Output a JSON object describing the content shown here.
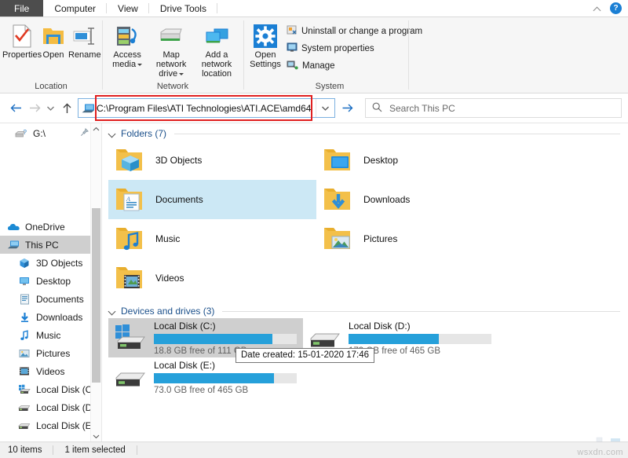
{
  "window": {
    "tabs": [
      {
        "label": "File",
        "type": "file"
      },
      {
        "label": "Computer",
        "type": "active"
      },
      {
        "label": "View",
        "type": "normal"
      },
      {
        "label": "Drive Tools",
        "type": "normal"
      }
    ],
    "collapse_ribbon_icon": "chevron-up-icon",
    "help_icon": "help-icon",
    "help_label": "?"
  },
  "ribbon": {
    "groups": [
      {
        "title": "Location",
        "buttons": [
          {
            "label": "Properties",
            "icon": "properties-icon"
          },
          {
            "label": "Open",
            "icon": "open-folder-icon"
          },
          {
            "label": "Rename",
            "icon": "rename-icon"
          }
        ]
      },
      {
        "title": "Network",
        "buttons": [
          {
            "label": "Access media",
            "icon": "access-media-icon",
            "dropdown": true
          },
          {
            "label": "Map network drive",
            "icon": "map-network-drive-icon",
            "dropdown": true
          },
          {
            "label": "Add a network location",
            "icon": "add-network-location-icon",
            "dropdown": false
          }
        ]
      },
      {
        "title": "System",
        "buttons": [
          {
            "label": "Open Settings",
            "icon": "settings-gear-icon"
          }
        ],
        "small_buttons": [
          {
            "label": "Uninstall or change a program",
            "icon": "uninstall-program-icon"
          },
          {
            "label": "System properties",
            "icon": "system-properties-icon"
          },
          {
            "label": "Manage",
            "icon": "manage-icon"
          }
        ]
      }
    ]
  },
  "navbar": {
    "back_icon": "arrow-left-icon",
    "forward_icon": "arrow-right-icon",
    "recent_icon": "chevron-down-icon",
    "up_icon": "arrow-up-icon",
    "address_icon": "this-pc-icon",
    "address_value": "C:\\Program Files\\ATI Technologies\\ATI.ACE\\amd64",
    "address_dropdown_icon": "chevron-down-icon",
    "go_icon": "go-arrow-icon",
    "search_icon": "search-icon",
    "search_placeholder": "Search This PC",
    "highlight_color": "#e02020"
  },
  "sidebar": {
    "items": [
      {
        "label": "G:\\",
        "icon": "network-drive-icon",
        "level": 1,
        "selected": false,
        "pinned": true
      },
      {
        "label": "OneDrive",
        "icon": "onedrive-icon",
        "level": 0,
        "selected": false,
        "pinned": false
      },
      {
        "label": "This PC",
        "icon": "this-pc-icon",
        "level": 0,
        "selected": true,
        "pinned": false
      },
      {
        "label": "3D Objects",
        "icon": "3d-objects-icon",
        "level": 1,
        "selected": false,
        "pinned": false
      },
      {
        "label": "Desktop",
        "icon": "desktop-icon",
        "level": 1,
        "selected": false,
        "pinned": false
      },
      {
        "label": "Documents",
        "icon": "documents-icon",
        "level": 1,
        "selected": false,
        "pinned": false
      },
      {
        "label": "Downloads",
        "icon": "downloads-icon",
        "level": 1,
        "selected": false,
        "pinned": false
      },
      {
        "label": "Music",
        "icon": "music-icon",
        "level": 1,
        "selected": false,
        "pinned": false
      },
      {
        "label": "Pictures",
        "icon": "pictures-icon",
        "level": 1,
        "selected": false,
        "pinned": false
      },
      {
        "label": "Videos",
        "icon": "videos-icon",
        "level": 1,
        "selected": false,
        "pinned": false
      },
      {
        "label": "Local Disk (C:)",
        "icon": "windows-disk-icon",
        "level": 1,
        "selected": false,
        "pinned": false
      },
      {
        "label": "Local Disk (D:)",
        "icon": "disk-icon",
        "level": 1,
        "selected": false,
        "pinned": false
      },
      {
        "label": "Local Disk (E:)",
        "icon": "disk-icon",
        "level": 1,
        "selected": false,
        "pinned": false
      }
    ],
    "scroll_up_icon": "chevron-up-icon",
    "scroll_down_icon": "chevron-down-icon"
  },
  "content": {
    "folders_group": {
      "title": "Folders (7)",
      "items": [
        {
          "label": "3D Objects",
          "icon": "folder-3d-objects-icon",
          "selected": false
        },
        {
          "label": "Desktop",
          "icon": "folder-desktop-icon",
          "selected": false
        },
        {
          "label": "Documents",
          "icon": "folder-documents-icon",
          "selected": true
        },
        {
          "label": "Downloads",
          "icon": "folder-downloads-icon",
          "selected": false
        },
        {
          "label": "Music",
          "icon": "folder-music-icon",
          "selected": false
        },
        {
          "label": "Pictures",
          "icon": "folder-pictures-icon",
          "selected": false
        },
        {
          "label": "Videos",
          "icon": "folder-videos-icon",
          "selected": false
        }
      ]
    },
    "drives_group": {
      "title": "Devices and drives (3)",
      "items": [
        {
          "label": "Local Disk (C:)",
          "icon": "windows-drive-icon",
          "free_text": "18.8 GB free of 111 GB",
          "used_percent": 83,
          "selected": true
        },
        {
          "label": "Local Disk (D:)",
          "icon": "drive-icon",
          "free_text": "173 GB free of 465 GB",
          "used_percent": 63,
          "selected": false
        },
        {
          "label": "Local Disk (E:)",
          "icon": "drive-icon",
          "free_text": "73.0 GB free of 465 GB",
          "used_percent": 84,
          "selected": false
        }
      ]
    },
    "tooltip": "Date created: 15-01-2020 17:46"
  },
  "statusbar": {
    "item_count": "10 items",
    "selection": "1 item selected",
    "watermark": "wsxdn.com"
  }
}
